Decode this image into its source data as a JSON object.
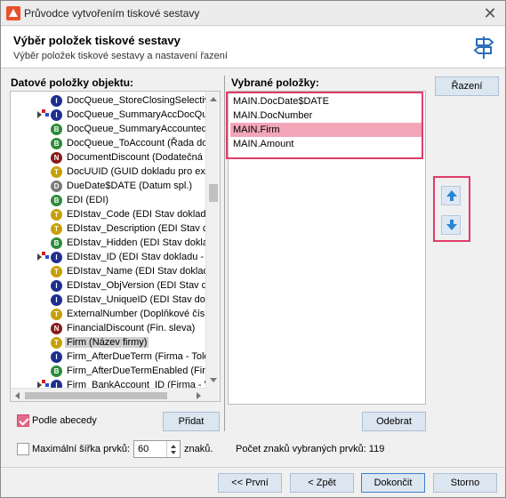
{
  "window": {
    "title": "Průvodce vytvořením tiskové sestavy"
  },
  "header": {
    "title": "Výběr položek tiskové sestavy",
    "subtitle": "Výběr položek tiskové sestavy a nastavení řazení"
  },
  "left_panel": {
    "label": "Datové položky objektu:",
    "items": [
      {
        "label": "DocQueue_StoreClosingSelectiv",
        "type": "I",
        "color": "#1f2f8f",
        "expand": false,
        "selected": false
      },
      {
        "label": "DocQueue_SummaryAccDocQue",
        "type": "I",
        "color": "#1f2f8f",
        "expand": true,
        "selected": false
      },
      {
        "label": "DocQueue_SummaryAccounted",
        "type": "B",
        "color": "#2e8b3a",
        "expand": false,
        "selected": false
      },
      {
        "label": "DocQueue_ToAccount (Řada do",
        "type": "B",
        "color": "#2e8b3a",
        "expand": false,
        "selected": false
      },
      {
        "label": "DocumentDiscount (Dodatečná s",
        "type": "N",
        "color": "#8b1a1a",
        "expand": false,
        "selected": false
      },
      {
        "label": "DocUUID (GUID dokladu pro exp",
        "type": "T",
        "color": "#c8a000",
        "expand": false,
        "selected": false
      },
      {
        "label": "DueDate$DATE (Datum spl.)",
        "type": "D",
        "color": "#7a7a7a",
        "expand": false,
        "selected": false
      },
      {
        "label": "EDI (EDI)",
        "type": "B",
        "color": "#2e8b3a",
        "expand": false,
        "selected": false
      },
      {
        "label": "EDIstav_Code (EDI Stav doklad",
        "type": "T",
        "color": "#c8a000",
        "expand": false,
        "selected": false
      },
      {
        "label": "EDIstav_Description (EDI Stav c",
        "type": "T",
        "color": "#c8a000",
        "expand": false,
        "selected": false
      },
      {
        "label": "EDIstav_Hidden (EDI Stav doklad",
        "type": "B",
        "color": "#2e8b3a",
        "expand": false,
        "selected": false
      },
      {
        "label": "EDIstav_ID (EDI Stav dokladu -",
        "type": "I",
        "color": "#1f2f8f",
        "expand": true,
        "selected": false
      },
      {
        "label": "EDIstav_Name (EDI Stav doklad",
        "type": "T",
        "color": "#c8a000",
        "expand": false,
        "selected": false
      },
      {
        "label": "EDIstav_ObjVersion (EDI Stav do",
        "type": "I",
        "color": "#1f2f8f",
        "expand": false,
        "selected": false
      },
      {
        "label": "EDIstav_UniqueID (EDI Stav dok",
        "type": "I",
        "color": "#1f2f8f",
        "expand": false,
        "selected": false
      },
      {
        "label": "ExternalNumber (Doplňkové čísl",
        "type": "T",
        "color": "#c8a000",
        "expand": false,
        "selected": false
      },
      {
        "label": "FinancialDiscount (Fin. sleva)",
        "type": "N",
        "color": "#8b1a1a",
        "expand": false,
        "selected": false
      },
      {
        "label": "Firm (Název firmy)",
        "type": "T",
        "color": "#c8a000",
        "expand": false,
        "selected": true
      },
      {
        "label": "Firm_AfterDueTerm (Firma - Tole",
        "type": "I",
        "color": "#1f2f8f",
        "expand": false,
        "selected": false
      },
      {
        "label": "Firm_AfterDueTermEnabled (Firm",
        "type": "B",
        "color": "#2e8b3a",
        "expand": false,
        "selected": false
      },
      {
        "label": "Firm_BankAccount_ID (Firma - V",
        "type": "I",
        "color": "#1f2f8f",
        "expand": true,
        "selected": false
      }
    ]
  },
  "right_panel": {
    "label": "Vybrané položky:",
    "items": [
      {
        "label": "MAIN.DocDate$DATE",
        "highlight": false
      },
      {
        "label": "MAIN.DocNumber",
        "highlight": false
      },
      {
        "label": "MAIN.Firm",
        "highlight": true
      },
      {
        "label": "MAIN.Amount",
        "highlight": false
      }
    ]
  },
  "buttons": {
    "sort": "Řazení",
    "add": "Přidat",
    "remove": "Odebrat",
    "first": "<< První",
    "back": "< Zpět",
    "finish": "Dokončit",
    "cancel": "Storno"
  },
  "options": {
    "alphabetical_label": "Podle abecedy",
    "alphabetical_checked": true,
    "max_width_label": "Maximální šířka prvků:",
    "max_width_checked": false,
    "max_width_value": "60",
    "chars_label": "znaků.",
    "selected_count": "Počet znaků vybraných prvků: 119"
  },
  "colors": {
    "highlight": "#f4a6b9",
    "annotation_box": "#e03c6a",
    "button": "#dce6f1"
  }
}
